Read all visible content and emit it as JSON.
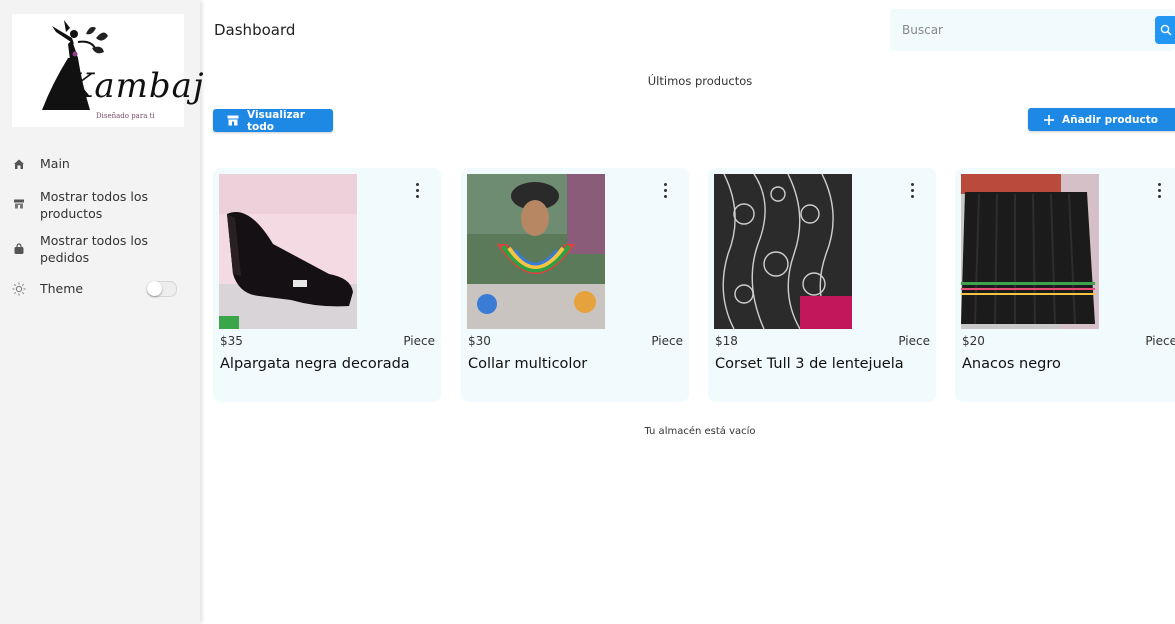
{
  "sidebar": {
    "logo_text": "Kambaj",
    "logo_tagline": "Diseñado para ti",
    "items": [
      {
        "label": "Main",
        "icon": "home-icon"
      },
      {
        "label": "Mostrar todos los productos",
        "icon": "store-icon"
      },
      {
        "label": "Mostrar todos los pedidos",
        "icon": "bag-icon"
      },
      {
        "label": "Theme",
        "icon": "sun-icon"
      }
    ],
    "theme_toggle_on": false
  },
  "header": {
    "title": "Dashboard",
    "search_placeholder": "Buscar",
    "search_icon": "search-icon"
  },
  "main": {
    "section_title": "Últimos productos",
    "view_all_label": "Visualizar todo",
    "add_product_label": "Añadir producto",
    "products": [
      {
        "price": "$35",
        "unit": "Piece",
        "name": "Alpargata negra decorada"
      },
      {
        "price": "$30",
        "unit": "Piece",
        "name": "Collar multicolor"
      },
      {
        "price": "$18",
        "unit": "Piece",
        "name": "Corset Tull 3 de lentejuela"
      },
      {
        "price": "$20",
        "unit": "Piece",
        "name": "Anacos negro"
      }
    ],
    "empty_message": "Tu almacén está vacío"
  },
  "colors": {
    "accent": "#1e88e5",
    "card_bg": "#f1fbfd",
    "sidebar_bg": "#f3f3f3"
  }
}
